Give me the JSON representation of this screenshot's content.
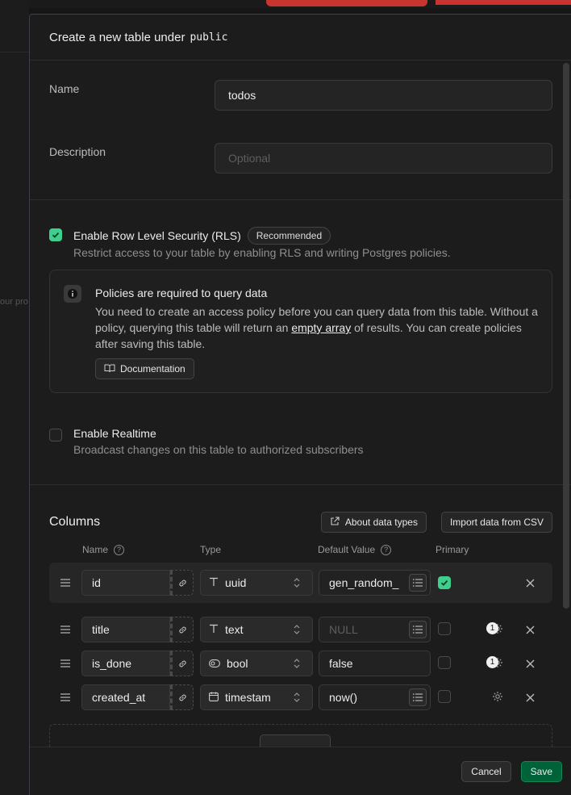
{
  "background": {
    "ghost_text": "our pro"
  },
  "panel": {
    "title": "Create a new table under",
    "schema": "public"
  },
  "form": {
    "name_label": "Name",
    "name_value": "todos",
    "description_label": "Description",
    "description_placeholder": "Optional"
  },
  "rls": {
    "label": "Enable Row Level Security (RLS)",
    "badge": "Recommended",
    "description": "Restrict access to your table by enabling RLS and writing Postgres policies.",
    "checked": true
  },
  "alert": {
    "title": "Policies are required to query data",
    "text_before": "You need to create an access policy before you can query data from this table. Without a policy, querying this table will return an ",
    "link": "empty array",
    "text_after": " of results. You can create policies after saving this table.",
    "button": "Documentation"
  },
  "realtime": {
    "label": "Enable Realtime",
    "description": "Broadcast changes on this table to authorized subscribers",
    "checked": false
  },
  "columns": {
    "title": "Columns",
    "about_button": "About data types",
    "import_button": "Import data from CSV",
    "header": {
      "name": "Name",
      "type": "Type",
      "default": "Default Value",
      "primary": "Primary"
    },
    "rows": [
      {
        "name": "id",
        "type": "uuid",
        "type_icon": "text-T-icon",
        "default": "gen_random_",
        "default_placeholder": false,
        "primary": true,
        "badge": ""
      },
      {
        "name": "title",
        "type": "text",
        "type_icon": "text-T-icon",
        "default": "NULL",
        "default_placeholder": true,
        "primary": false,
        "badge": "1"
      },
      {
        "name": "is_done",
        "type": "bool",
        "type_icon": "toggle-icon",
        "default": "false",
        "default_placeholder": false,
        "primary": false,
        "badge": "1"
      },
      {
        "name": "created_at",
        "type": "timestam",
        "type_icon": "calendar-icon",
        "default": "now()",
        "default_placeholder": false,
        "primary": false,
        "badge": ""
      }
    ]
  },
  "footer": {
    "cancel": "Cancel",
    "save": "Save"
  },
  "colors": {
    "accent": "#3ecf8e",
    "save_bg": "#006239",
    "bg": "#1c1c1c"
  }
}
